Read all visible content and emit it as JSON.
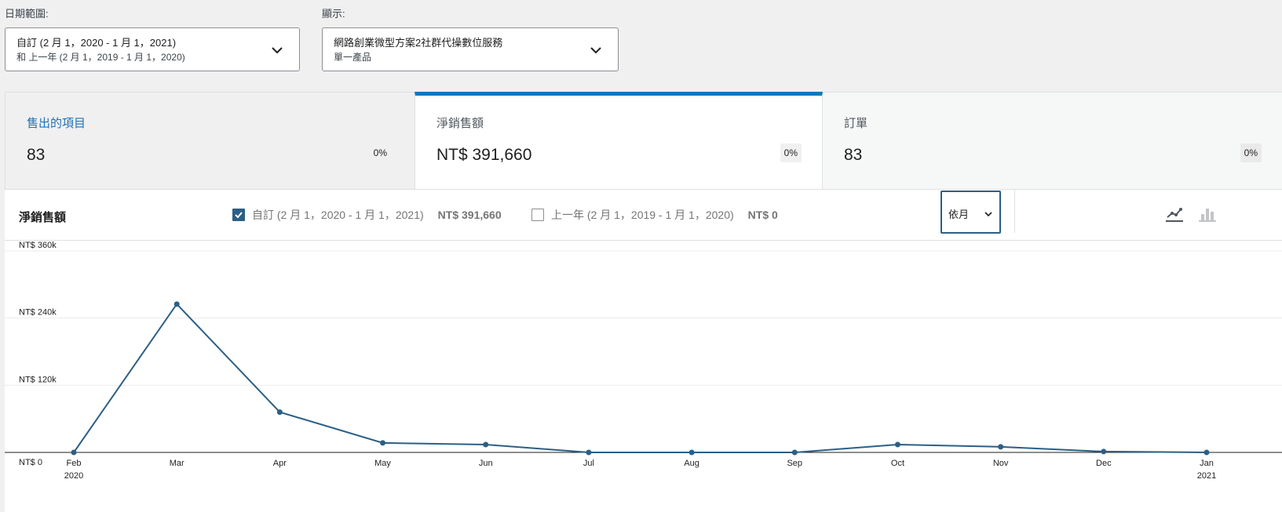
{
  "filters": {
    "date_range": {
      "label": "日期範圍:",
      "main": "自訂 (2 月 1，2020 - 1 月 1，2021)",
      "sub": "和 上一年 (2 月 1，2019 - 1 月 1，2020)"
    },
    "show": {
      "label": "顯示:",
      "main": "網路創業微型方案2社群代操數位服務",
      "sub": "單一產品"
    }
  },
  "cards": [
    {
      "label": "售出的項目",
      "value": "83",
      "delta": "0%"
    },
    {
      "label": "淨銷售額",
      "value": "NT$ 391,660",
      "delta": "0%"
    },
    {
      "label": "訂單",
      "value": "83",
      "delta": "0%"
    }
  ],
  "chart_header": {
    "title": "淨銷售額",
    "legend": [
      {
        "label": "自訂 (2 月 1，2020 - 1 月 1，2021)",
        "value": "NT$ 391,660",
        "checked": true
      },
      {
        "label": "上一年 (2 月 1，2019 - 1 月 1，2020)",
        "value": "NT$ 0",
        "checked": false
      }
    ],
    "interval": "依月",
    "chart_types": [
      "line-chart-icon",
      "bar-chart-icon"
    ]
  },
  "colors": {
    "accent": "#007cba",
    "series": "#2c5f86"
  },
  "chart_data": {
    "type": "line",
    "x": [
      "Feb",
      "Mar",
      "Apr",
      "May",
      "Jun",
      "Jul",
      "Aug",
      "Sep",
      "Oct",
      "Nov",
      "Dec",
      "Jan"
    ],
    "x_year_labels": {
      "Feb": "2020",
      "Jan": "2021"
    },
    "y_ticks": [
      "NT$ 0",
      "NT$ 120k",
      "NT$ 240k",
      "NT$ 360k"
    ],
    "ylim": [
      0,
      360000
    ],
    "series": [
      {
        "name": "自訂 (2 月 1，2020 - 1 月 1，2021)",
        "values": [
          0,
          265000,
          72000,
          17000,
          14000,
          0,
          0,
          0,
          14000,
          10000,
          1500,
          0
        ]
      }
    ],
    "grid": true
  }
}
